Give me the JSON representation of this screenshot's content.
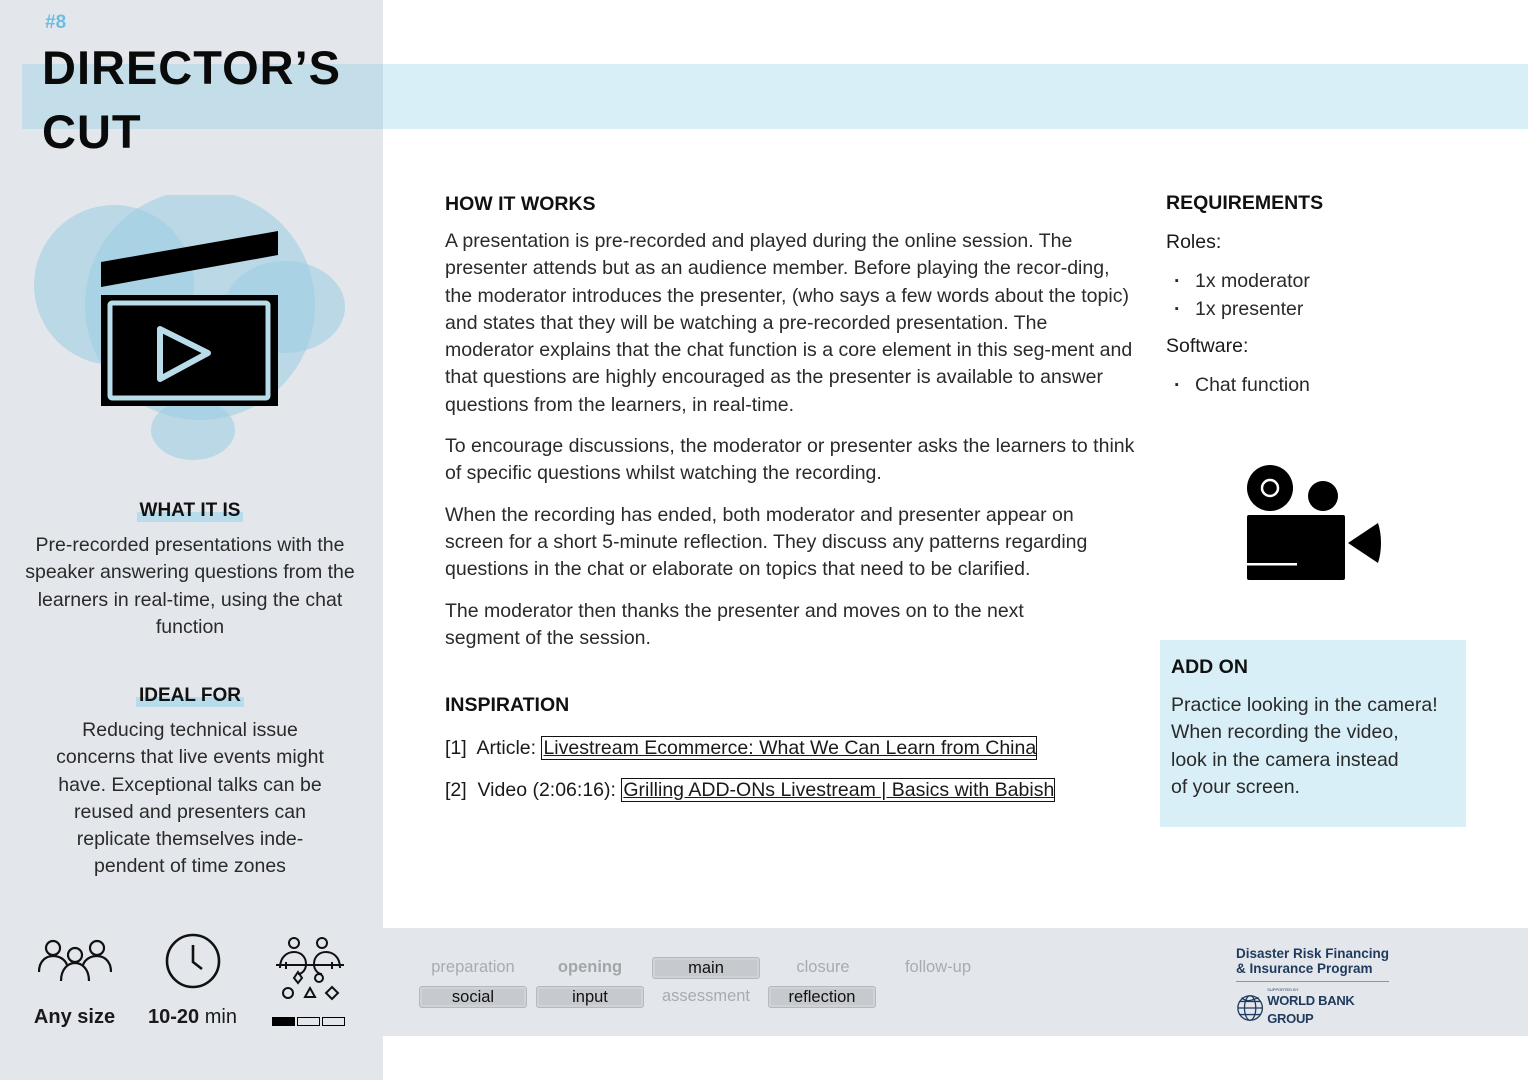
{
  "card": {
    "number": "#8",
    "title_line1": "DIRECTOR’S",
    "title_line2": "CUT",
    "hero_icon": "film-clapperboard-play-icon"
  },
  "sidebar": {
    "what_it_is": {
      "heading": "WHAT IT IS",
      "text": "Pre-recorded presentations with the speaker answering questions from the learners in real-time, using the chat function"
    },
    "ideal_for": {
      "heading": "IDEAL FOR",
      "text": "Reducing technical issue concerns that live events might have. Exceptional talks can be reused and presenters can replicate themselves inde-pendent of time zones"
    },
    "stats": {
      "group_size": {
        "icon": "group-people-icon",
        "value": "Any size"
      },
      "duration": {
        "icon": "clock-icon",
        "value_bold": "10-20",
        "unit": " min"
      },
      "complexity": {
        "icon": "interaction-people-shapes-icon",
        "level": 1,
        "max": 3
      }
    }
  },
  "how_it_works": {
    "heading": "HOW IT WORKS",
    "paragraphs": [
      "A presentation is pre-recorded and played during the online session. The presenter attends but as an audience member. Before playing the recor-ding, the moderator introduces the presenter, (who says a few words about the topic) and states that they will be watching a pre-recorded presentation. The moderator explains that the chat function is a core element in this seg-ment and that questions are highly encouraged as the presenter is available to answer questions from the learners, in real-time.",
      "To encourage discussions, the moderator or presenter asks the learners to think of specific questions whilst watching the recording.",
      "When the recording has ended, both moderator and presenter appear on screen for a short 5-minute reflection. They discuss any patterns regarding questions in the chat or elaborate on topics that need to be clarified.",
      "The moderator then thanks the presenter and moves on to the next segment of the session."
    ]
  },
  "inspiration": {
    "heading": "INSPIRATION",
    "items": [
      {
        "prefix": "[1]  Article: ",
        "link": "Livestream Ecommerce: What We Can Learn from China"
      },
      {
        "prefix": "[2]  Video (2:06:16): ",
        "link": "Grilling ADD-ONs Livestream | Basics with Babish"
      }
    ]
  },
  "requirements": {
    "heading": "REQUIREMENTS",
    "roles_label": "Roles:",
    "roles": [
      "1x moderator",
      "1x presenter"
    ],
    "software_label": "Software:",
    "software": [
      "Chat function"
    ],
    "icon": "video-camera-icon"
  },
  "add_on": {
    "heading": "ADD ON",
    "lines": [
      "Practice looking in the camera!",
      "When recording the video,",
      "look in the camera instead",
      "of your screen."
    ]
  },
  "footer": {
    "phases": [
      {
        "label": "preparation",
        "state": "inactive"
      },
      {
        "label": "opening",
        "state": "inactive"
      },
      {
        "label": "main",
        "state": "active"
      },
      {
        "label": "closure",
        "state": "inactive"
      },
      {
        "label": "follow-up",
        "state": "inactive"
      }
    ],
    "types": [
      {
        "label": "social",
        "state": "active"
      },
      {
        "label": "input",
        "state": "active"
      },
      {
        "label": "assessment",
        "state": "inactive"
      },
      {
        "label": "reflection",
        "state": "active"
      }
    ],
    "logo": {
      "title_line1": "Disaster Risk Financing",
      "title_line2": "& Insurance Program",
      "supported_by": "SUPPORTED BY",
      "org": "WORLD BANK GROUP"
    }
  },
  "colors": {
    "sidebar_bg": "#e3e7ec",
    "accent_light_blue": "#d8eff8",
    "accent_blue": "#6cbde0",
    "highlight": "#b9dcec"
  }
}
